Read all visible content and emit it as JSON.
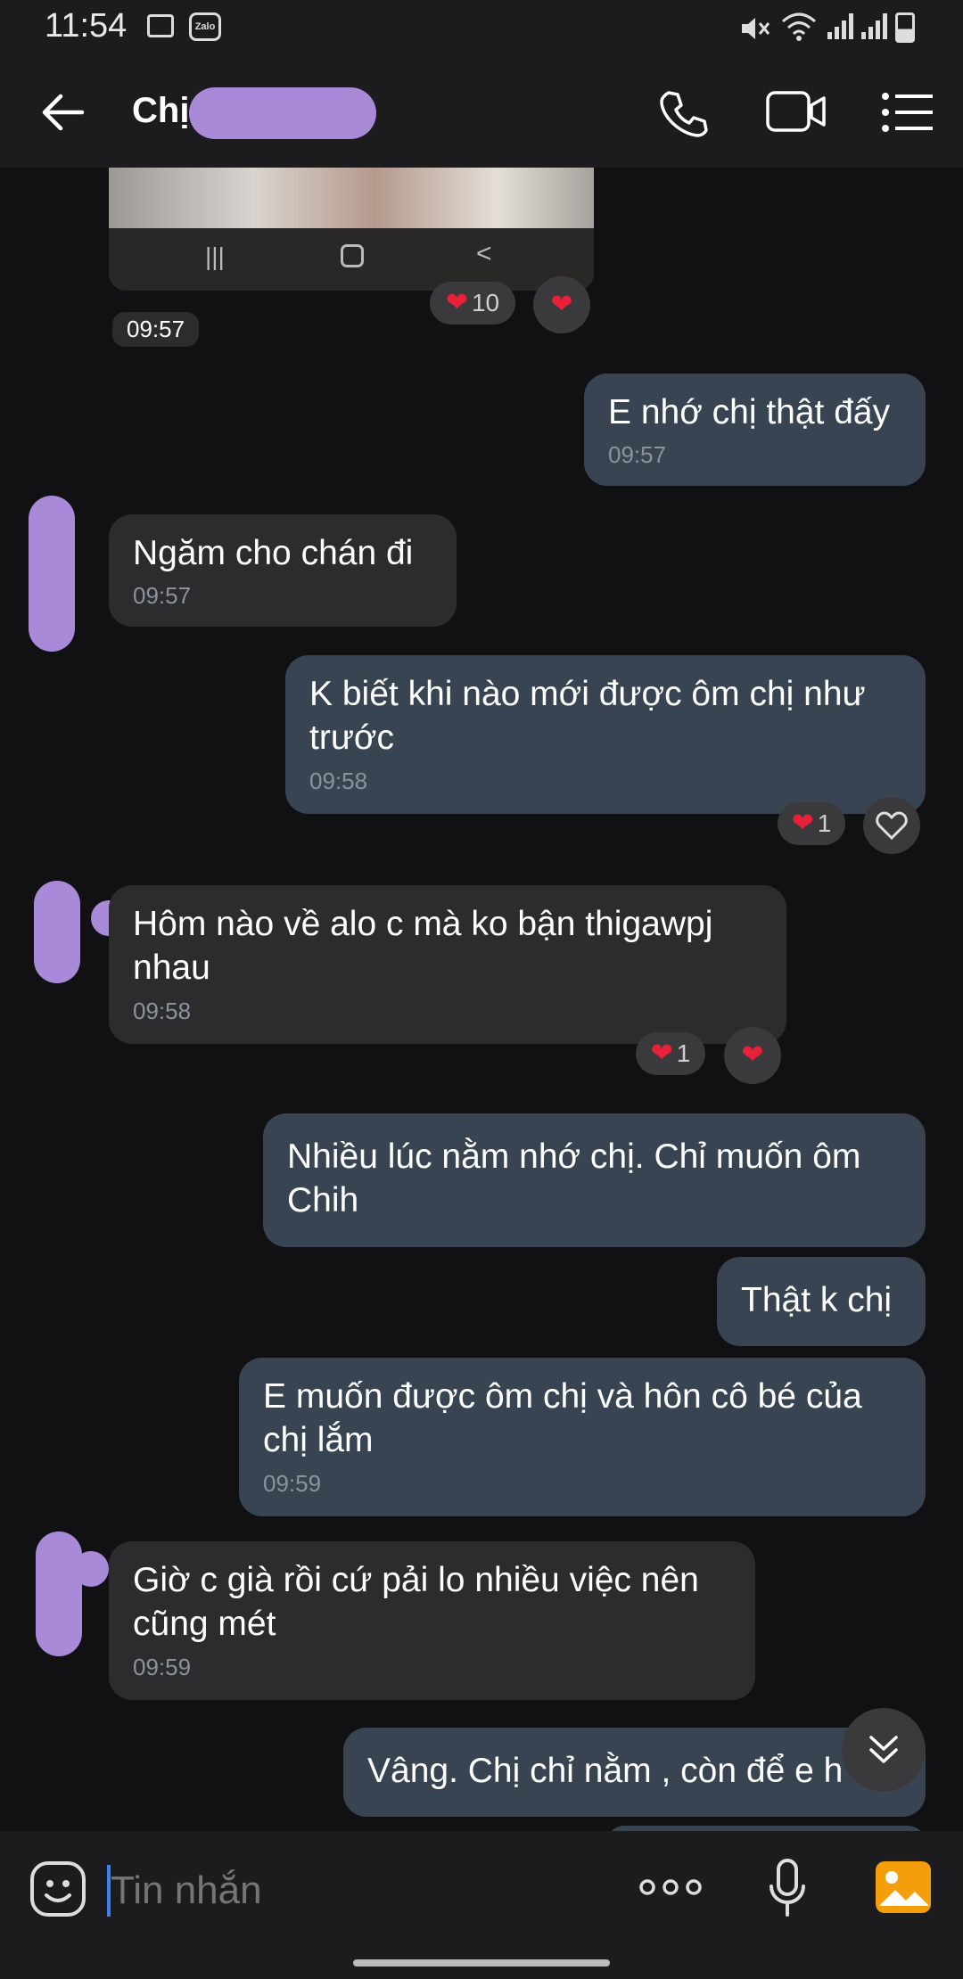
{
  "status_bar": {
    "time": "11:54",
    "zalo_label": "Zalo"
  },
  "header": {
    "title": "Chị"
  },
  "image_message": {
    "time_chip": "09:57",
    "reaction_count": "10"
  },
  "messages": [
    {
      "dir": "out",
      "text": "E nhớ chị thật đấy",
      "time": "09:57"
    },
    {
      "dir": "in",
      "text": "Ngăm cho chán đi",
      "time": "09:57"
    },
    {
      "dir": "out",
      "text": "K biết khi nào mới được ôm chị như trước",
      "time": "09:58",
      "reaction_count": "1"
    },
    {
      "dir": "in",
      "text": "Hôm nào về alo c mà ko bận thigawpj nhau",
      "time": "09:58",
      "reaction_count": "1"
    },
    {
      "dir": "out",
      "text": "Nhiều lúc nằm nhớ chị. Chỉ muốn ôm Chih"
    },
    {
      "dir": "out",
      "text": "Thật k chị"
    },
    {
      "dir": "out",
      "text": "E muốn được ôm chị và hôn cô bé của chị lắm",
      "time": "09:59"
    },
    {
      "dir": "in",
      "text": "Giờ c già rồi cứ pải lo nhiều việc nên cũng mét",
      "time": "09:59"
    },
    {
      "dir": "out",
      "text": "Vâng. Chị chỉ nằm , còn để e h"
    }
  ],
  "input": {
    "placeholder": "Tin nhắn"
  },
  "colors": {
    "accent": "#3b82f6",
    "heart": "#e8203a",
    "censor": "#a98ad8",
    "gallery": "#f59e0b"
  }
}
